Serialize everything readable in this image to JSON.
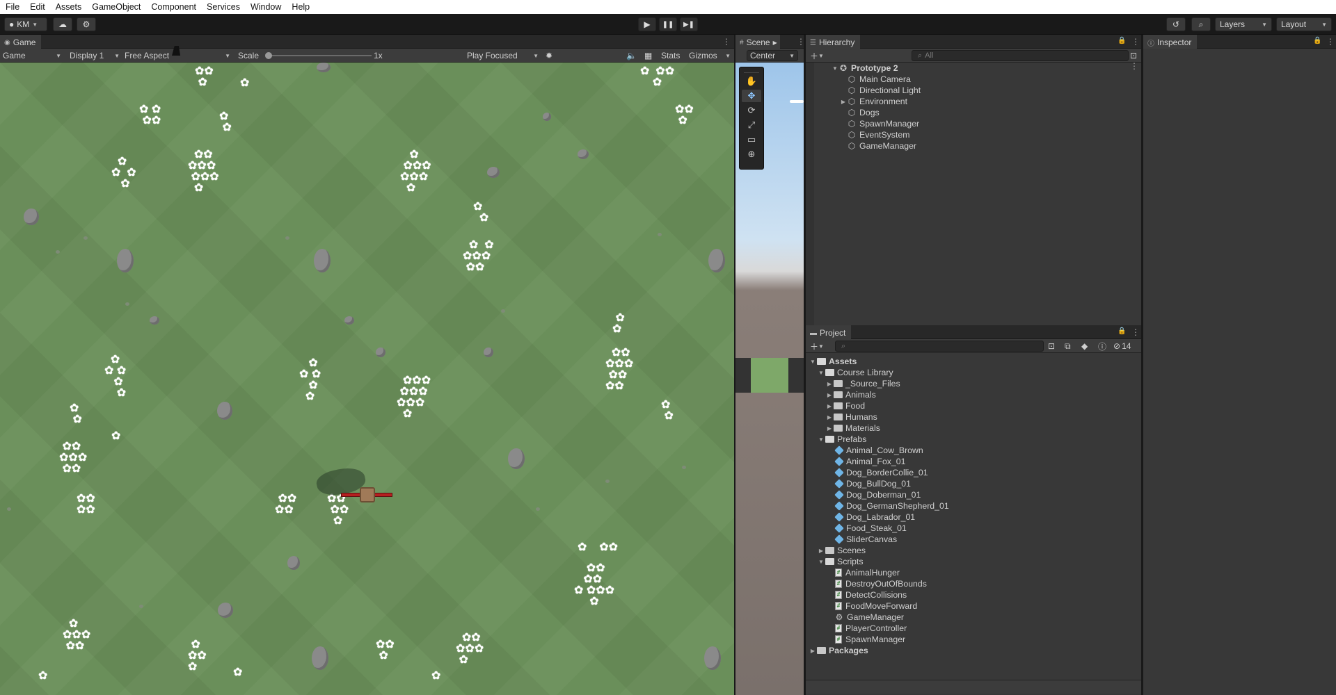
{
  "menu": [
    "File",
    "Edit",
    "Assets",
    "GameObject",
    "Component",
    "Services",
    "Window",
    "Help"
  ],
  "toolbar": {
    "account": "KM",
    "layers": "Layers",
    "layout": "Layout"
  },
  "game": {
    "tab": "Game",
    "mode": "Game",
    "display": "Display 1",
    "aspect": "Free Aspect",
    "scale_label": "Scale",
    "scale_value": "1x",
    "play_mode": "Play Focused",
    "stats": "Stats",
    "gizmos": "Gizmos"
  },
  "scene": {
    "tab": "Scene",
    "pivot": "Center"
  },
  "hierarchy": {
    "tab": "Hierarchy",
    "search_placeholder": "All",
    "root": "Prototype 2",
    "items": [
      "Main Camera",
      "Directional Light",
      "Environment",
      "Dogs",
      "SpawnManager",
      "EventSystem",
      "GameManager"
    ]
  },
  "inspector": {
    "tab": "Inspector"
  },
  "project": {
    "tab": "Project",
    "count": "14",
    "assets": "Assets",
    "course_library": "Course Library",
    "course_children": [
      "_Source_Files",
      "Animals",
      "Food",
      "Humans",
      "Materials"
    ],
    "prefabs": "Prefabs",
    "prefab_items": [
      "Animal_Cow_Brown",
      "Animal_Fox_01",
      "Dog_BorderCollie_01",
      "Dog_BullDog_01",
      "Dog_Doberman_01",
      "Dog_GermanShepherd_01",
      "Dog_Labrador_01",
      "Food_Steak_01",
      "SliderCanvas"
    ],
    "scenes": "Scenes",
    "scripts": "Scripts",
    "script_items": [
      "AnimalHunger",
      "DestroyOutOfBounds",
      "DetectCollisions",
      "FoodMoveForward",
      "GameManager",
      "PlayerController",
      "SpawnManager"
    ],
    "packages": "Packages"
  },
  "icons": {
    "play": "play-icon",
    "pause": "pause-icon",
    "step": "step-icon",
    "cloud": "cloud-icon",
    "history": "history-icon",
    "search": "search-icon"
  }
}
